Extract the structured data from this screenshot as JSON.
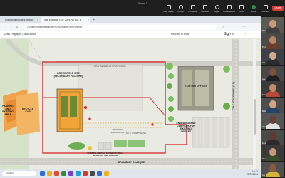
{
  "meeting": {
    "title": "Room 7",
    "tools": [
      {
        "label": "New share",
        "icon": "share-icon"
      },
      {
        "label": "Pause",
        "icon": "pause-icon"
      },
      {
        "label": "Annotate",
        "icon": "pen-icon"
      },
      {
        "label": "Remote",
        "icon": "remote-icon"
      },
      {
        "label": "Apps",
        "icon": "apps-icon"
      },
      {
        "label": "Whiteboards",
        "icon": "whiteboard-icon"
      },
      {
        "label": "Chat",
        "icon": "chat-icon"
      },
      {
        "label": "Share",
        "icon": "share-screen-icon"
      },
      {
        "label": "Record",
        "icon": "record-icon"
      }
    ],
    "leave_label": "Leave"
  },
  "browser": {
    "tabs": [
      {
        "label": "Construction Site Entrance"
      },
      {
        "label": "Site Entrance PDF 2024_v2 (1) - A"
      }
    ],
    "new_tab": "+",
    "url": "C:/Users/Documents/Site%20Entrance%20PDF.pdf",
    "toolbar_left": "Draw  |  Highlight  |  Read aloud",
    "toolbar_right": "Find text or tools",
    "signin": "Sign in"
  },
  "plan": {
    "labels": {
      "brownfield": "BROWNFIELD SITE (SECONDARY FACTORY)",
      "parking": "PARKING AND EXISTING AREA",
      "recycle": "RECYCLE CAR",
      "existing_offices": "EXISTING OFFICES",
      "entrance": "ENTRANCE AND CAR PARK FOR EXISTING OFFICES",
      "compound": "SITE COMPOUND",
      "fence": "EXISTING 2M HIGH BOUNDARY WALL WITH POST AND LIGHTING",
      "road_bottom": "BRAMBLEY ROAD (3 E)",
      "road_right": "C.R.C. STATION WAY (3 E)",
      "unit_label": "NEW BUILDING PROPOSED",
      "landscape": "PROPOSED LANDSCAPING"
    }
  },
  "taskbar": {
    "search": "Search",
    "time": "10:42",
    "date": "05/07/2024",
    "app_colors": [
      "#2b6fd6",
      "#f2b01e",
      "#e34a2f",
      "#2d8f3c",
      "#7a3fd1",
      "#1ea1d6",
      "#d6362b",
      "#4a4a4a",
      "#2b6fd6",
      "#f2b01e"
    ]
  },
  "participants": [
    {
      "name": "Tom",
      "skin": "#c99a7a",
      "shirt": "#3d3d3d",
      "bg": "#5a5a52"
    },
    {
      "name": "Priya",
      "skin": "#b98260",
      "shirt": "#6a3d2a",
      "bg": "#4a4a48"
    },
    {
      "name": "Jon",
      "skin": "#d2a88a",
      "shirt": "#2b2b2b",
      "bg": "#3c3f45"
    },
    {
      "name": "Ade",
      "skin": "#7a5038",
      "shirt": "#1f1f1f",
      "bg": "#474747"
    },
    {
      "name": "Sara",
      "skin": "#c48a68",
      "shirt": "#b94a3a",
      "bg": "#3a3a3a"
    },
    {
      "name": "Mike",
      "skin": "#d4a482",
      "shirt": "#224466",
      "bg": "#4d4d4d"
    },
    {
      "name": "Kwame",
      "skin": "#6a4330",
      "shirt": "#e0e0e0",
      "bg": "#555"
    },
    {
      "name": "Femi",
      "skin": "#5e3a28",
      "shirt": "#2a2a2a",
      "bg": "#4a4a4a"
    },
    {
      "name": "Dan",
      "skin": "#c9977a",
      "shirt": "#3a4a2a",
      "bg": "#3a3a3a"
    },
    {
      "name": "Joy",
      "skin": "#8a5a3e",
      "shirt": "#d9b23a",
      "bg": "#505050"
    }
  ],
  "colors": {
    "site_boundary": "#d71f26",
    "building_orange": "#f0a13a",
    "existing_offices": "#9a9a8a",
    "green": "#8cc47a",
    "road": "#cfcfc8"
  }
}
